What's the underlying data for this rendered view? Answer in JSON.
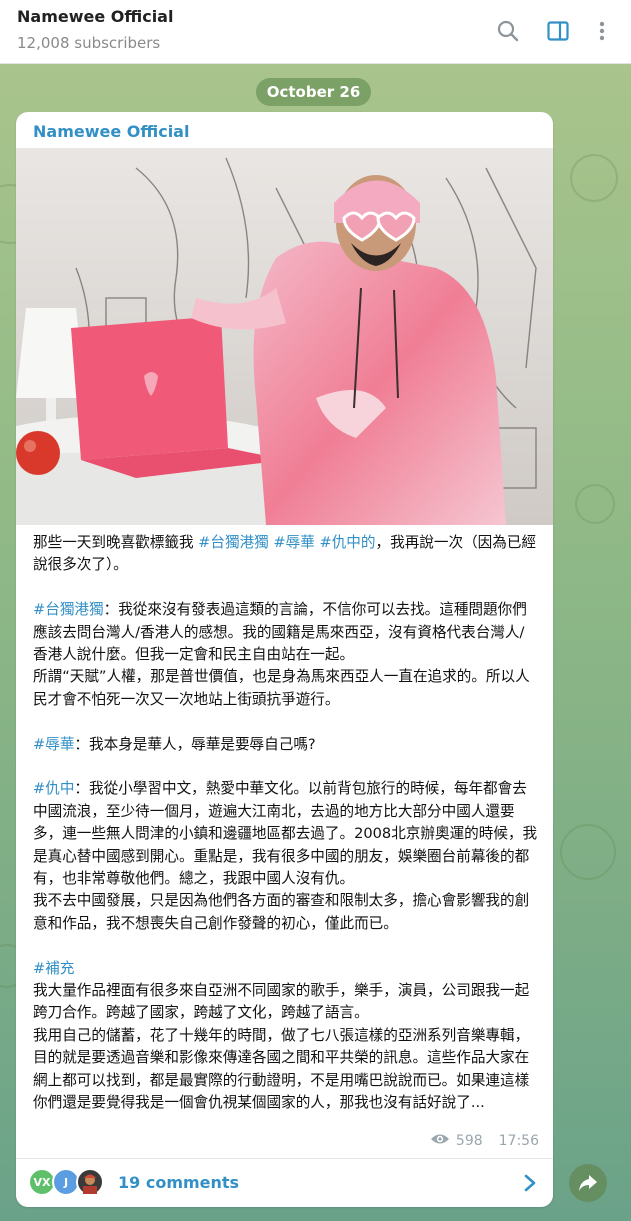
{
  "header": {
    "title": "Namewee Official",
    "subtitle": "12,008 subscribers",
    "icons": [
      "search-icon",
      "sidebar-toggle-icon",
      "more-vertical-icon"
    ],
    "accent": "#3390c7"
  },
  "chat": {
    "date_label": "October 26"
  },
  "post": {
    "author": "Namewee Official",
    "lines": {
      "l1a": "那些一天到晚喜歡標籤我 ",
      "l1tag1": "#台獨港獨",
      "l1tag2": "#辱華",
      "l1tag3": "#仇中的",
      "l1b": "，我再說一次（因為已經說很多次了）。",
      "p2tag": "#台獨港獨",
      "p2": "：我從來沒有發表過這類的言論，不信你可以去找。這種問題你們應該去問台灣人/香港人的感想。我的國籍是馬來西亞，沒有資格代表台灣人/香港人說什麼。但我一定會和民主自由站在一起。\n所謂“天賦”人權，那是普世價值，也是身為馬來西亞人一直在追求的。所以人民才會不怕死一次又一次地站上街頭抗爭遊行。",
      "p3tag": "#辱華",
      "p3": "：我本身是華人，辱華是要辱自己嗎?",
      "p4tag": "#仇中",
      "p4": "：我從小學習中文，熱愛中華文化。以前背包旅行的時候，每年都會去中國流浪，至少待一個月，遊遍大江南北，去過的地方比大部分中國人還要多，連一些無人問津的小鎮和邊疆地區都去過了。2008北京辦奧運的時候，我是真心替中國感到開心。重點是，我有很多中國的朋友，娛樂圈台前幕後的都有，也非常尊敬他們。總之，我跟中國人沒有仇。\n我不去中國發展，只是因為他們各方面的審查和限制太多，擔心會影響我的創意和作品，我不想喪失自己創作發聲的初心，僅此而已。",
      "p5tag": "#補充",
      "p5": "我大量作品裡面有很多來自亞洲不同國家的歌手，樂手，演員，公司跟我一起跨刀合作。跨越了國家，跨越了文化，跨越了語言。\n我用自己的儲蓄，花了十幾年的時間，做了七八張這樣的亞洲系列音樂專輯，目的就是要透過音樂和影像來傳達各國之間和平共榮的訊息。這些作品大家在網上都可以找到，都是最實際的行動證明，不是用嘴巴說說而已。如果連這樣你們還是要覺得我是一個會仇視某個國家的人，那我也沒有話好說了..."
    },
    "views": "598",
    "time": "17:56",
    "comments": {
      "label": "19 comments",
      "avatars": [
        {
          "initials": "VX",
          "color": "#5fbf6b"
        },
        {
          "initials": "J",
          "color": "#5a9de0"
        },
        {
          "initials": "",
          "color": "#3a3a3a"
        }
      ]
    }
  }
}
